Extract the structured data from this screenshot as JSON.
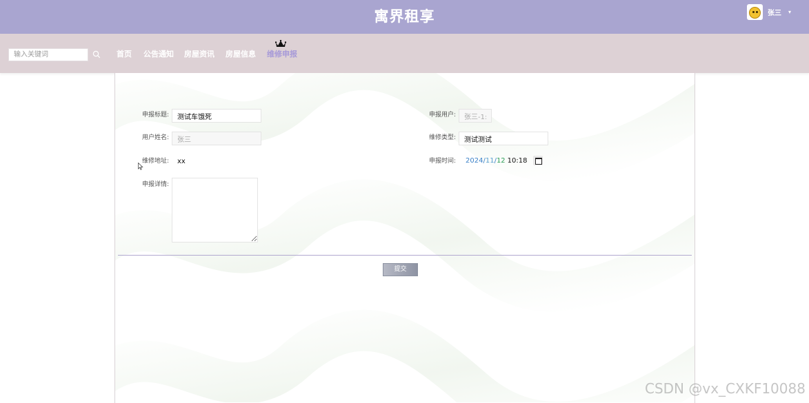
{
  "header": {
    "site_title": "寓界租享",
    "user": {
      "name": "张三"
    }
  },
  "nav": {
    "search_placeholder": "输入关键词",
    "items": [
      {
        "label": "首页",
        "active": false
      },
      {
        "label": "公告通知",
        "active": false
      },
      {
        "label": "房屋资讯",
        "active": false
      },
      {
        "label": "房屋信息",
        "active": false
      },
      {
        "label": "维修申报",
        "active": true
      }
    ]
  },
  "form": {
    "title_label": "申报标题:",
    "title_value": "测试车饿死",
    "reporter_label": "申报用户:",
    "reporter_value": "张三-1:",
    "username_label": "用户姓名:",
    "username_value": "张三",
    "repair_type_label": "维修类型:",
    "repair_type_value": "测试测试",
    "address_label": "维修地址:",
    "address_value": "xx",
    "time_label": "申报时间:",
    "time_year": "2024",
    "time_month": "11",
    "time_day": "12",
    "time_clock": "10:18",
    "detail_label": "申报详情:",
    "submit_label": "提交"
  },
  "watermark": "CSDN @vx_CXKF10088",
  "colors": {
    "header_bg": "#a9a5d0",
    "navbar_bg": "#ddd1d5",
    "active_nav": "#a79ad8",
    "divider": "#b1a9cf"
  }
}
